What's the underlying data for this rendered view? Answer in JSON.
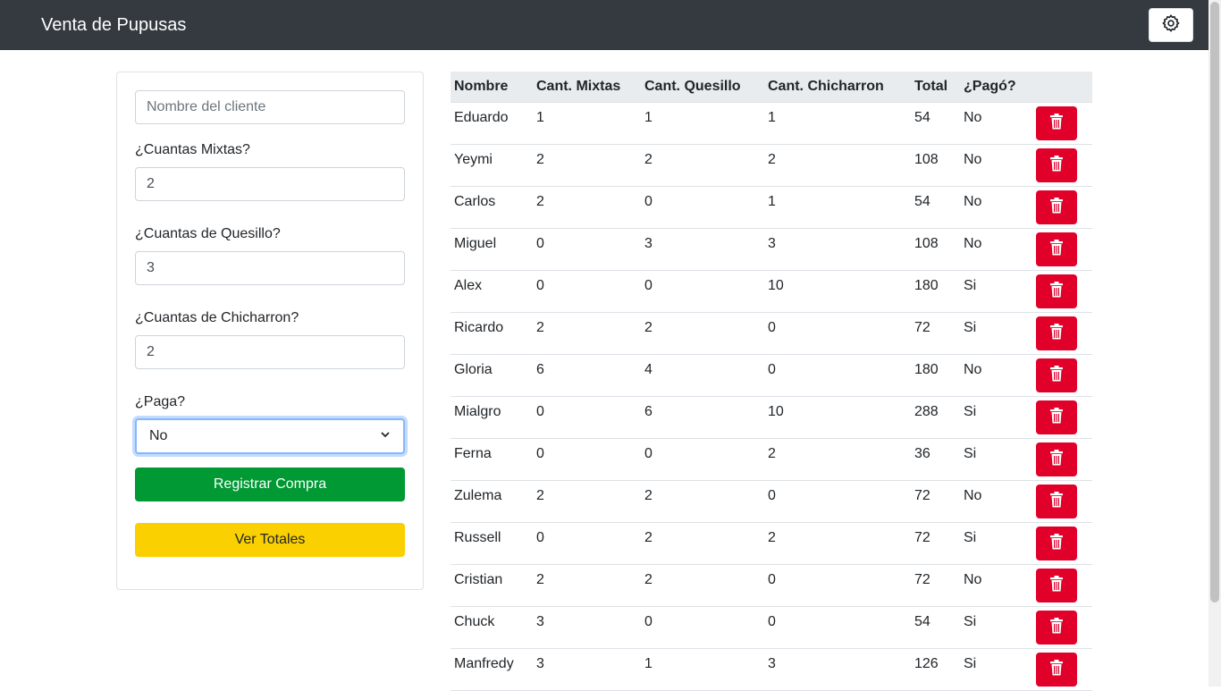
{
  "navbar": {
    "brand": "Venta de Pupusas",
    "settings_icon": "gear-icon"
  },
  "form": {
    "name_placeholder": "Nombre del cliente",
    "name_value": "",
    "mixtas_label": "¿Cuantas Mixtas?",
    "mixtas_value": "2",
    "quesillo_label": "¿Cuantas de Quesillo?",
    "quesillo_value": "3",
    "chicharron_label": "¿Cuantas de Chicharron?",
    "chicharron_value": "2",
    "paga_label": "¿Paga?",
    "paga_value": "No",
    "register_button": "Registrar Compra",
    "totals_button": "Ver Totales"
  },
  "colors": {
    "navbar": "#343a40",
    "green": "#009933",
    "yellow": "#fad000",
    "delete": "#e0002a"
  },
  "table": {
    "headers": [
      "Nombre",
      "Cant. Mixtas",
      "Cant. Quesillo",
      "Cant. Chicharron",
      "Total",
      "¿Pagó?"
    ],
    "rows": [
      [
        "Eduardo",
        "1",
        "1",
        "1",
        "54",
        "No"
      ],
      [
        "Yeymi",
        "2",
        "2",
        "2",
        "108",
        "No"
      ],
      [
        "Carlos",
        "2",
        "0",
        "1",
        "54",
        "No"
      ],
      [
        "Miguel",
        "0",
        "3",
        "3",
        "108",
        "No"
      ],
      [
        "Alex",
        "0",
        "0",
        "10",
        "180",
        "Si"
      ],
      [
        "Ricardo",
        "2",
        "2",
        "0",
        "72",
        "Si"
      ],
      [
        "Gloria",
        "6",
        "4",
        "0",
        "180",
        "No"
      ],
      [
        "Mialgro",
        "0",
        "6",
        "10",
        "288",
        "Si"
      ],
      [
        "Ferna",
        "0",
        "0",
        "2",
        "36",
        "Si"
      ],
      [
        "Zulema",
        "2",
        "2",
        "0",
        "72",
        "No"
      ],
      [
        "Russell",
        "0",
        "2",
        "2",
        "72",
        "Si"
      ],
      [
        "Cristian",
        "2",
        "2",
        "0",
        "72",
        "No"
      ],
      [
        "Chuck",
        "3",
        "0",
        "0",
        "54",
        "Si"
      ],
      [
        "Manfredy",
        "3",
        "1",
        "3",
        "126",
        "Si"
      ]
    ]
  }
}
